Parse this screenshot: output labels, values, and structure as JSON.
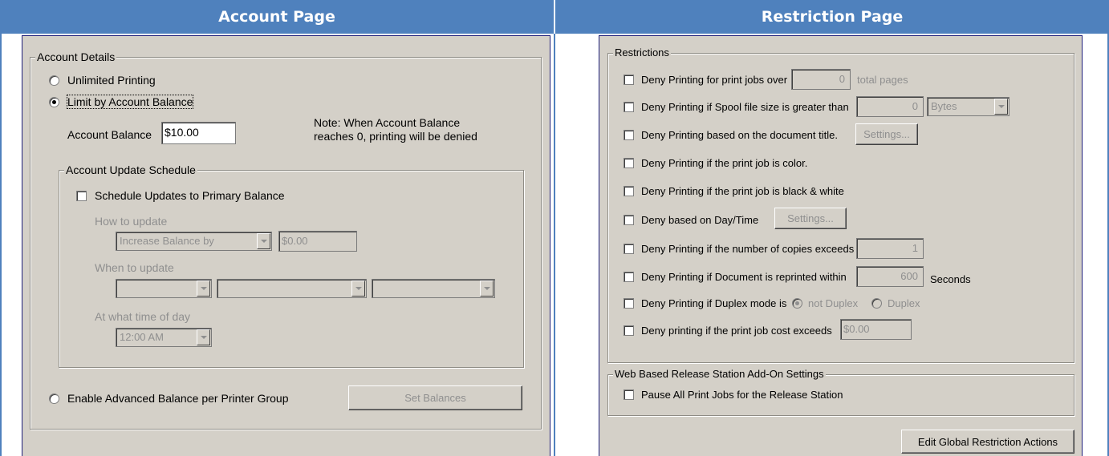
{
  "headers": {
    "left": "Account Page",
    "right": "Restriction Page"
  },
  "account": {
    "group_title": "Account Details",
    "unlimited_label": "Unlimited Printing",
    "limit_label": "Limit by Account Balance",
    "balance_label": "Account Balance",
    "balance_value": "$10.00",
    "note_line1": "Note: When Account Balance",
    "note_line2": "reaches 0, printing will be denied",
    "schedule": {
      "group_title": "Account Update Schedule",
      "checkbox_label": "Schedule Updates to Primary Balance",
      "how_label": "How to update",
      "how_value": "Increase Balance by",
      "amount_value": "$0.00",
      "when_label": "When to update",
      "when_values": [
        "",
        "",
        ""
      ],
      "time_label": "At what time of day",
      "time_value": "12:00 AM"
    },
    "advanced_label": "Enable Advanced Balance per Printer Group",
    "set_balances_label": "Set Balances"
  },
  "restrictions": {
    "group_title": "Restrictions",
    "pages_label": "Deny Printing for print jobs over",
    "pages_value": "0",
    "pages_suffix": "total pages",
    "spool_label": "Deny Printing if Spool file size is greater than",
    "spool_value": "0",
    "spool_unit": "Bytes",
    "title_label": "Deny Printing based on the document title.",
    "title_settings": "Settings...",
    "color_label": "Deny Printing if the print job is color.",
    "bw_label": "Deny Printing if the print job is black & white",
    "daytime_label": "Deny based on Day/Time",
    "daytime_settings": "Settings...",
    "copies_label": "Deny Printing if the number of copies exceeds",
    "copies_value": "1",
    "reprint_label": "Deny Printing if Document is reprinted within",
    "reprint_value": "600",
    "reprint_unit": "Seconds",
    "duplex_label": "Deny Printing if Duplex mode is",
    "duplex_opt1": "not Duplex",
    "duplex_opt2": "Duplex",
    "cost_label": "Deny printing if the print job cost exceeds",
    "cost_value": "$0.00"
  },
  "release": {
    "group_title": "Web Based Release Station Add-On Settings",
    "pause_label": "Pause All Print Jobs for the Release Station"
  },
  "edit_global_label": "Edit Global Restriction Actions"
}
